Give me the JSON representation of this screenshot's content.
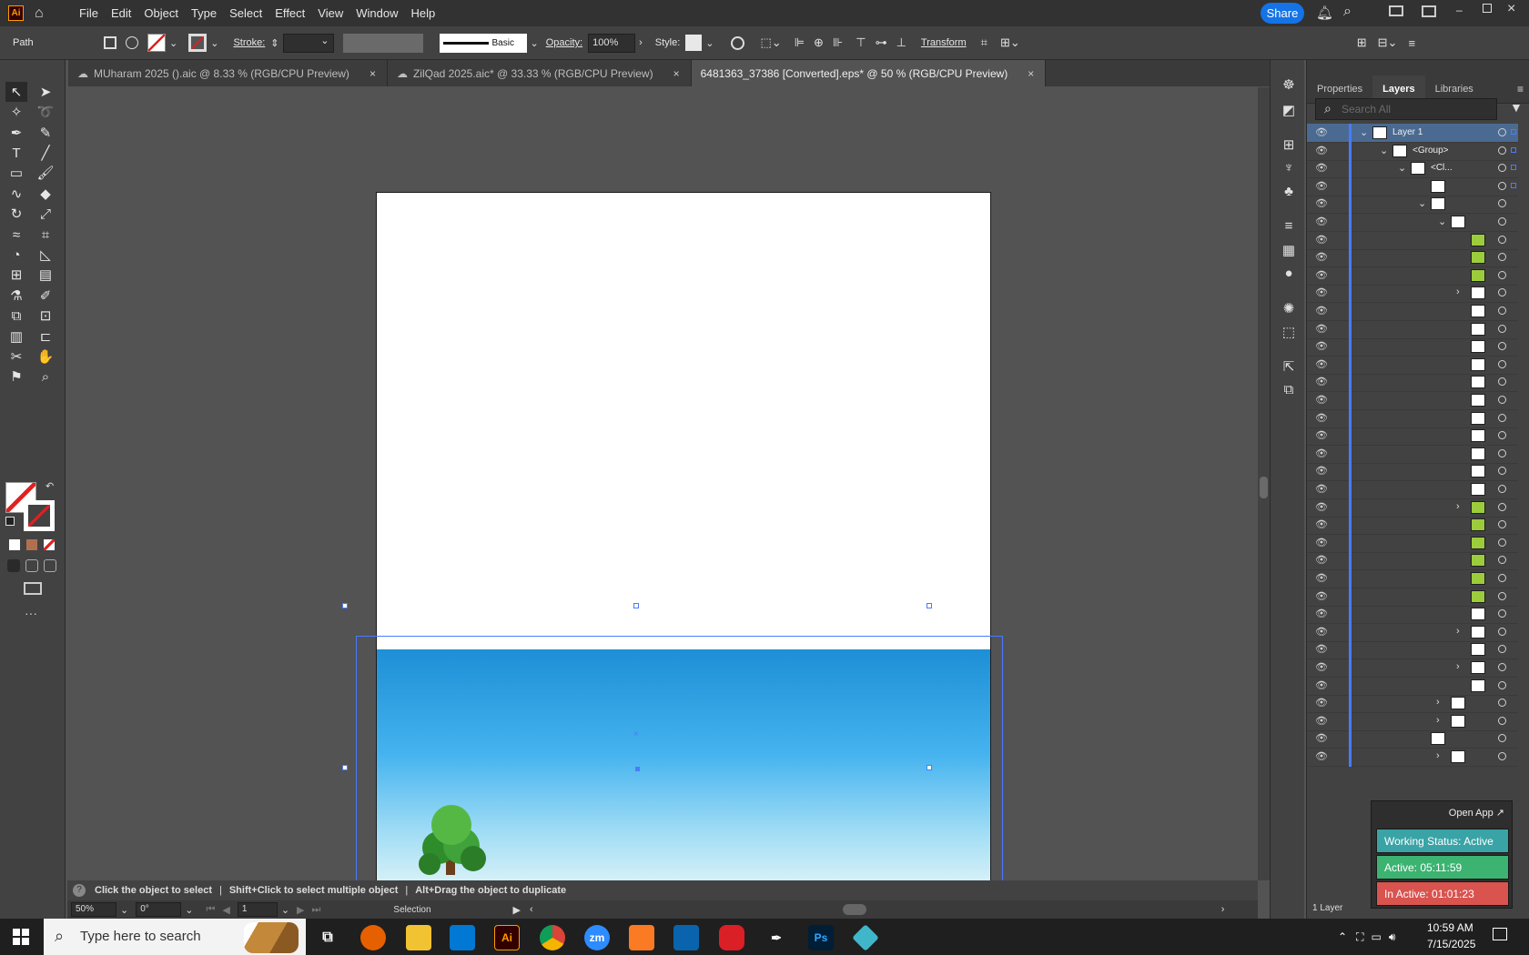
{
  "menu": {
    "items": [
      "File",
      "Edit",
      "Object",
      "Type",
      "Select",
      "Effect",
      "View",
      "Window",
      "Help"
    ],
    "share_label": "Share"
  },
  "control_bar": {
    "object_type": "Path",
    "stroke_label": "Stroke:",
    "brush_name": "Basic",
    "opacity_label": "Opacity:",
    "opacity_value": "100%",
    "style_label": "Style:",
    "transform_label": "Transform"
  },
  "tabs": [
    {
      "label": "MUharam 2025 ().aic @ 8.33 % (RGB/CPU Preview)"
    },
    {
      "label": "ZilQad 2025.aic* @ 33.33 % (RGB/CPU Preview)"
    },
    {
      "label": "6481363_37386 [Converted].eps* @ 50 % (RGB/CPU Preview)"
    }
  ],
  "close_glyph": "×",
  "status": {
    "hint_1": "Click the object to select",
    "sep": "|",
    "hint_2": "Shift+Click to select multiple object",
    "hint_3": "Alt+Drag the object to duplicate"
  },
  "bottom": {
    "zoom": "50%",
    "rotation": "0°",
    "artboard_num": "1",
    "tool_name": "Selection"
  },
  "panel": {
    "tabs": [
      "Properties",
      "Layers",
      "Libraries"
    ],
    "search_placeholder": "Search All",
    "layer_name": "Layer 1",
    "group_name": "<Group>",
    "clip_name": "<Cl...",
    "layer_count": "1 Layer"
  },
  "tracker": {
    "open_app": "Open App ↗",
    "working": "Working Status: Active",
    "active": "Active: 05:11:59",
    "inactive": "In Active: 01:01:23",
    "colors": {
      "working": "#3aa3a6",
      "active": "#3cb371",
      "inactive": "#d9534f"
    }
  },
  "taskbar": {
    "search_text": "Type here to search",
    "time": "10:59 AM",
    "date": "7/15/2025",
    "apps": [
      "Ai",
      "zm",
      "Ps"
    ]
  }
}
